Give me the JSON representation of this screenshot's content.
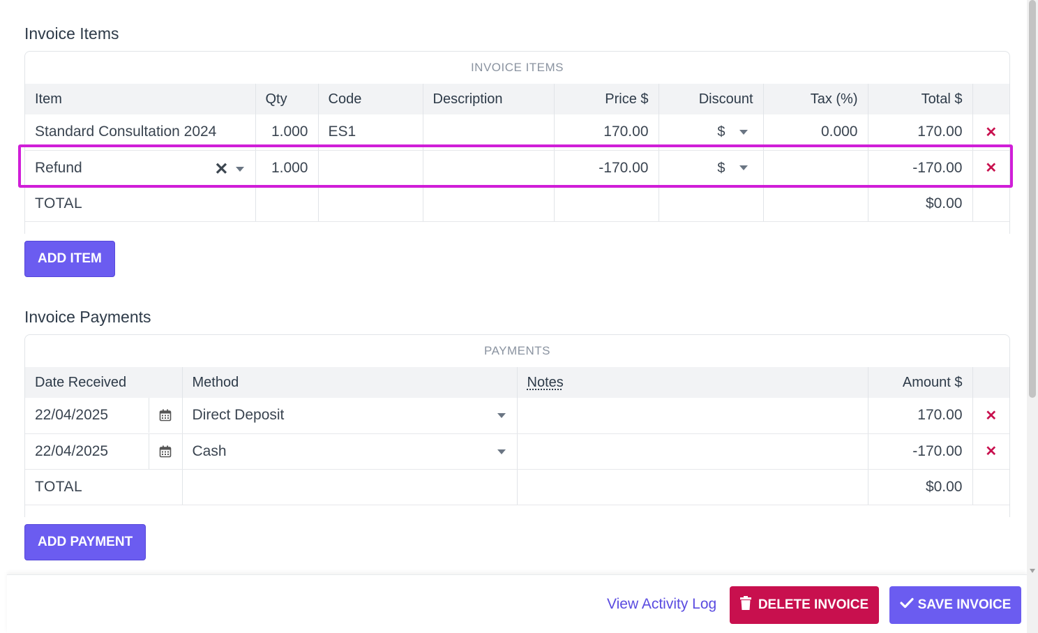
{
  "items_section": {
    "title": "Invoice Items",
    "caption": "INVOICE ITEMS",
    "headers": [
      "Item",
      "Qty",
      "Code",
      "Description",
      "Price $",
      "Discount",
      "Tax (%)",
      "Total $"
    ],
    "rows": [
      {
        "item": "Standard Consultation 2024",
        "qty": "1.000",
        "code": "ES1",
        "description": "",
        "price": "170.00",
        "discount": "$",
        "tax": "0.000",
        "total": "170.00"
      },
      {
        "item": "Refund",
        "qty": "1.000",
        "code": "",
        "description": "",
        "price": "-170.00",
        "discount": "$",
        "tax": "",
        "total": "-170.00"
      }
    ],
    "total_label": "TOTAL",
    "total_value": "$0.00",
    "add_button": "ADD ITEM"
  },
  "payments_section": {
    "title": "Invoice Payments",
    "caption": "PAYMENTS",
    "headers": [
      "Date Received",
      "Method",
      "Notes",
      "Amount $"
    ],
    "rows": [
      {
        "date": "22/04/2025",
        "method": "Direct Deposit",
        "notes": "",
        "amount": "170.00"
      },
      {
        "date": "22/04/2025",
        "method": "Cash",
        "notes": "",
        "amount": "-170.00"
      }
    ],
    "total_label": "TOTAL",
    "total_value": "$0.00",
    "add_button": "ADD PAYMENT"
  },
  "footer": {
    "activity_link": "View Activity Log",
    "delete_button": "DELETE INVOICE",
    "save_button": "SAVE INVOICE"
  },
  "icons": {
    "remove": "close-icon",
    "clear": "clear-icon",
    "dropdown": "chevron-down-icon",
    "calendar": "calendar-icon",
    "trash": "trash-icon",
    "check": "check-icon"
  },
  "colors": {
    "accent": "#6b5cf0",
    "danger": "#c8104e",
    "highlight": "#d01ed8"
  }
}
